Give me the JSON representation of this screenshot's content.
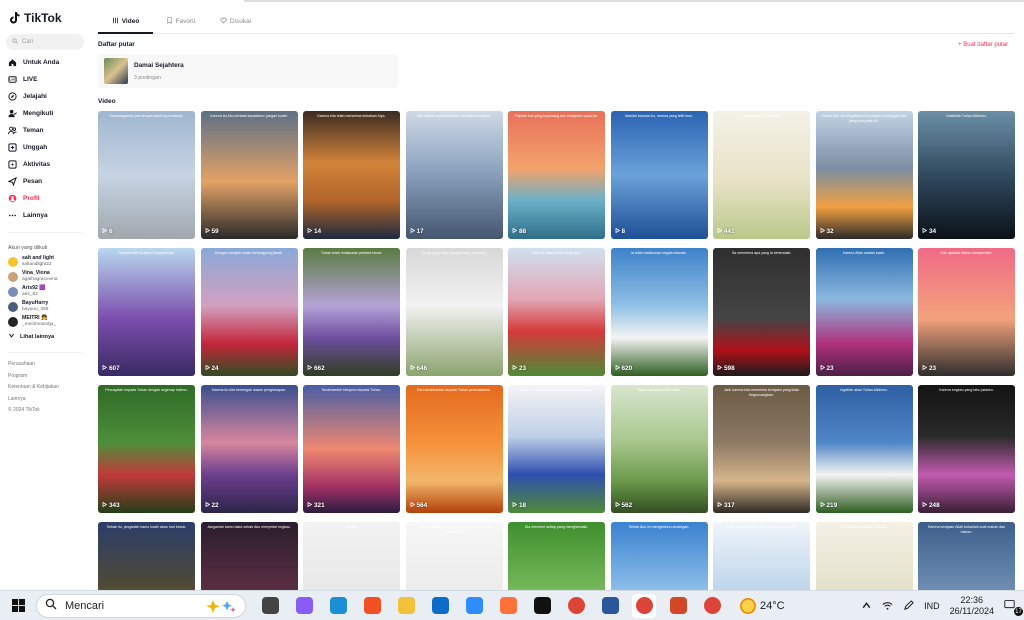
{
  "app": {
    "name": "TikTok",
    "search_placeholder": "Cari"
  },
  "nav": [
    {
      "key": "for-you",
      "label": "Untuk Anda",
      "icon": "home-icon"
    },
    {
      "key": "live",
      "label": "LIVE",
      "icon": "live-icon"
    },
    {
      "key": "explore",
      "label": "Jelajahi",
      "icon": "compass-icon"
    },
    {
      "key": "following",
      "label": "Mengikuti",
      "icon": "user-check-icon"
    },
    {
      "key": "friends",
      "label": "Teman",
      "icon": "friends-icon"
    },
    {
      "key": "upload",
      "label": "Unggah",
      "icon": "plus-square-icon"
    },
    {
      "key": "activity",
      "label": "Aktivitas",
      "icon": "bolt-icon"
    },
    {
      "key": "messages",
      "label": "Pesan",
      "icon": "send-icon"
    },
    {
      "key": "profile",
      "label": "Profil",
      "icon": "profile-icon"
    },
    {
      "key": "more",
      "label": "Lainnya",
      "icon": "more-icon"
    }
  ],
  "following_section": {
    "title": "Akun yang diikuti",
    "accounts": [
      {
        "name": "salt and light",
        "handle": "saltandlight22",
        "color": "#f4c430"
      },
      {
        "name": "Vina_Viona",
        "handle": "agathagracevina",
        "color": "#c9a27a"
      },
      {
        "name": "Aris92 🟪",
        "handle": "aris_92",
        "color": "#7a8db5"
      },
      {
        "name": "BayuHarry",
        "handle": "bayuuu_358",
        "color": "#4b5c7c"
      },
      {
        "name": "MEITRI 👧",
        "handle": "_mei3monintja_",
        "color": "#222"
      }
    ],
    "see_more": "Lihat lainnya"
  },
  "footer": [
    "Perusahaan",
    "Program",
    "Ketentuan & Kebijakan",
    "Lainnya",
    "© 2024 TikTok"
  ],
  "tabs": [
    {
      "label": "Video",
      "icon": "grid-icon",
      "active": true
    },
    {
      "label": "Favorit",
      "icon": "bookmark-icon",
      "active": false
    },
    {
      "label": "Disukai",
      "icon": "heart-icon",
      "active": false
    }
  ],
  "playlist_section": {
    "title": "Daftar putar",
    "create_label": "+ Buat daftar putar",
    "playlist": {
      "name": "Damai Sejahtera",
      "count": "3 postingan"
    }
  },
  "video_section": {
    "title": "Video"
  },
  "videos": [
    {
      "views": "6",
      "caption": "Kekuranganmu jadi tempat kasih-Nya bekerja.",
      "bg": "linear-gradient(180deg,#9fb6cf 0%,#c7d4e3 50%,#a0a7ad 100%)"
    },
    {
      "views": "59",
      "caption": "Karena itu Aku berkata kepadamu: jangan kuatir.",
      "bg": "linear-gradient(180deg,#5d6f86 0%,#e3a266 55%,#2a2a2a 100%)"
    },
    {
      "views": "14",
      "caption": "Karena kita telah menerima kebaikan-Nya.",
      "bg": "linear-gradient(180deg,#3b2b22 0%,#d2833a 40%,#b2642a 70%,#1e2a40 100%)"
    },
    {
      "views": "17",
      "caption": "Dan damai sejahtera Allah memelihara hatimu.",
      "bg": "linear-gradient(180deg,#cfd9e6 0%,#8ea5c1 45%,#45566f 100%)"
    },
    {
      "views": "88",
      "caption": "Filipilah kuk yang kupasang dan belajarlah pada-Ku.",
      "bg": "linear-gradient(180deg,#e8705a 0%,#f2a36d 45%,#6ab0c7 70%,#2f6e8a 100%)"
    },
    {
      "views": "8",
      "caption": "Marilah kepada-Ku, semua yang letih lesu.",
      "bg": "linear-gradient(180deg,#2a63b3 0%,#6aa2d9 50%,#1e4f96 100%)"
    },
    {
      "views": "441",
      "caption": "Akan tetapi Tuhan setia.",
      "bg": "linear-gradient(180deg,#f4f2e8 0%,#e8e2c6 55%,#b9c98a 100%)"
    },
    {
      "views": "32",
      "caption": "Sebab Aku ini mengetahui rancangan-rancangan apa yang ada pada-Ku.",
      "bg": "linear-gradient(180deg,#c2d4e4 0%,#7b8ea3 45%,#f2a041 75%,#2d2a2a 100%)"
    },
    {
      "views": "34",
      "caption": "Kasihilah Tuhan Allahmu.",
      "bg": "linear-gradient(180deg,#6b8fa6 0%,#2c4458 55%,#0b1218 100%)"
    },
    {
      "views": "607",
      "caption": "Serahkanlah kuatirmu kepada-Nya.",
      "bg": "linear-gradient(180deg,#b9d7ef 0%,#7b4fae 55%,#3a2a63 100%)"
    },
    {
      "views": "24",
      "caption": "Dengan menjadi selalu tertanggung jawab.",
      "bg": "linear-gradient(180deg,#8aa9d8 0%,#d2a0c0 45%,#c3263a 75%,#2f4d22 100%)"
    },
    {
      "views": "662",
      "caption": "Tuhan telah melakukan perkara besar.",
      "bg": "linear-gradient(180deg,#5a7c40 0%,#b4a2d8 45%,#6f4fa1 70%,#2f3e22 100%)"
    },
    {
      "views": "646",
      "caption": "Tuhan yang baik, supaya kamu diberkati.",
      "bg": "linear-gradient(180deg,#d8d8d8 0%,#f2f2f2 45%,#8ca46e 100%)"
    },
    {
      "views": "23",
      "caption": "Allah di dalam kasih setia-Nya.",
      "bg": "linear-gradient(180deg,#cfe0ef 0%,#e3a6b5 40%,#d43a3a 65%,#4f8a38 100%)"
    },
    {
      "views": "620",
      "caption": "Ia telah melakukan segala sesuatu.",
      "bg": "linear-gradient(180deg,#3e82c9 0%,#8fc0e6 45%,#f4f4f4 70%,#2f5e22 100%)"
    },
    {
      "views": "598",
      "caption": "Sa menerima apa yang Ia kehendaki.",
      "bg": "linear-gradient(180deg,#2f2f2f 0%,#454545 55%,#b0101a 80%,#1b1b1b 100%)"
    },
    {
      "views": "23",
      "caption": "Karena Allah adalah kasih.",
      "bg": "linear-gradient(180deg,#2f6fb1 0%,#8bb8e0 40%,#b0307c 75%,#4b2047 100%)"
    },
    {
      "views": "23",
      "caption": "Dan apabila dirimu memperoleh.",
      "bg": "linear-gradient(180deg,#ef6a86 0%,#f3a27c 55%,#2e2e2e 100%)"
    },
    {
      "views": "343",
      "caption": "Percayalah kepada Tuhan dengan segenap hatimu.",
      "bg": "linear-gradient(180deg,#2f6b26 0%,#4c8f3a 45%,#c23a3a 70%,#243f18 100%)"
    },
    {
      "views": "22",
      "caption": "Karena itu kita bermegah dalam pengharapan.",
      "bg": "linear-gradient(180deg,#3b4f8f 0%,#d7869e 45%,#6c3f8f 70%,#2d2448 100%)"
    },
    {
      "views": "321",
      "caption": "Serahkanlah hidupmu kepada Tuhan.",
      "bg": "linear-gradient(180deg,#4a5ea6 0%,#ef8870 50%,#a03066 80%,#2b1c3f 100%)"
    },
    {
      "views": "564",
      "caption": "Dan serahkanlah kepada Tuhan perbuatanmu.",
      "bg": "linear-gradient(180deg,#e46a1e 0%,#f5913b 45%,#f3b66a 75%,#b1400a 100%)"
    },
    {
      "views": "18",
      "caption": "Tuhan menunjukkan kasih-Nya kepada kamu.",
      "bg": "linear-gradient(180deg,#f4f4f4 0%,#c0d0e8 40%,#2f4fb0 70%,#4f8a38 100%)"
    },
    {
      "views": "562",
      "caption": "Tidak ada yang lebih indah.",
      "bg": "linear-gradient(180deg,#d8e6cf 0%,#a7c68a 45%,#6a9a4a 75%,#344d23 100%)"
    },
    {
      "views": "317",
      "caption": "Jadi, karena kita menerima kerajaan yang tidak tergoncangkan.",
      "bg": "linear-gradient(180deg,#6b5a45 0%,#8d7963 45%,#d7b58a 75%,#2e2a25 100%)"
    },
    {
      "views": "219",
      "caption": "Ingatlah akan Tuhan Allahmu.",
      "bg": "linear-gradient(180deg,#2e5fa3 0%,#4f86c7 45%,#f4f4f4 70%,#2f5e22 100%)"
    },
    {
      "views": "248",
      "caption": "Karena engkau yang tahu jalanku.",
      "bg": "linear-gradient(180deg,#141414 0%,#2a2a2a 40%,#c35ab0 70%,#3a1f36 100%)"
    },
    {
      "views": "",
      "caption": "Sebab itu, janganlah kamu kuatir akan hari besok.",
      "bg": "linear-gradient(180deg,#2b3d6a 0%,#4f4a36 50%,#e08d1c 100%)"
    },
    {
      "views": "",
      "caption": "Janganlah kamu takut sebab Aku menyertai engkau.",
      "bg": "linear-gradient(180deg,#2a1e2e 0%,#5c2e42 55%,#e86c7f 100%)"
    },
    {
      "views": "",
      "caption": "Sunday",
      "bg": "linear-gradient(180deg,#f2f2f2 0%,#e8e8e8 55%,#bfbfbf 100%)"
    },
    {
      "views": "",
      "caption": "Tuhan adalah baik bagi orang yang berharap kepada-Nya.",
      "bg": "linear-gradient(180deg,#f7f7f7 0%,#ebebeb 55%,#5d4fa8 100%)"
    },
    {
      "views": "",
      "caption": "Dia memberi setiap yang menghendaki.",
      "bg": "linear-gradient(180deg,#3f8f2e 0%,#77b95a 55%,#e8eef2 100%)"
    },
    {
      "views": "",
      "caption": "Sebab Aku ini mengetahui rancangan.",
      "bg": "linear-gradient(180deg,#3a82d0 0%,#8fc0ea 55%,#f1f4f8 100%)"
    },
    {
      "views": "",
      "caption": "Akhir suatu hal lebih baik daripada awalnya.",
      "bg": "linear-gradient(180deg,#f0f5fa 0%,#bcd4ea 55%,#2f73c0 100%)"
    },
    {
      "views": "",
      "caption": "Hal manusia menilai ketaatan.",
      "bg": "linear-gradient(180deg,#f4f1e5 0%,#e3e0c9 55%,#9bb57f 100%)"
    },
    {
      "views": "",
      "caption": "Karena kerajaan Allah bukanlah soal makan dan minum.",
      "bg": "linear-gradient(180deg,#3d5f8a 0%,#6f8fb3 55%,#1f3552 100%)"
    }
  ],
  "taskbar": {
    "search_label": "Mencari",
    "apps": [
      {
        "name": "task-view",
        "color": "#444"
      },
      {
        "name": "copilot",
        "color": "#8a5cf6"
      },
      {
        "name": "edge",
        "color": "#1a8fd6"
      },
      {
        "name": "store",
        "color": "#f25022"
      },
      {
        "name": "file-explorer",
        "color": "#f3c13a"
      },
      {
        "name": "outlook",
        "color": "#0b6cc9"
      },
      {
        "name": "zoom",
        "color": "#2d8cff"
      },
      {
        "name": "firefox",
        "color": "#ff7139"
      },
      {
        "name": "tiktok",
        "color": "#111"
      },
      {
        "name": "chrome",
        "color": "#db4437"
      },
      {
        "name": "word",
        "color": "#2b579a"
      },
      {
        "name": "chrome-active",
        "color": "#db4437"
      },
      {
        "name": "powerpoint",
        "color": "#d24726"
      },
      {
        "name": "chrome-profile",
        "color": "#db4437"
      }
    ],
    "weather": {
      "temp": "24°C",
      "badge": "1"
    },
    "language": "IND",
    "time": "22:36",
    "date": "26/11/2024",
    "notification_count": "17"
  },
  "colors": {
    "accent": "#fe2c55",
    "text": "#161823"
  }
}
